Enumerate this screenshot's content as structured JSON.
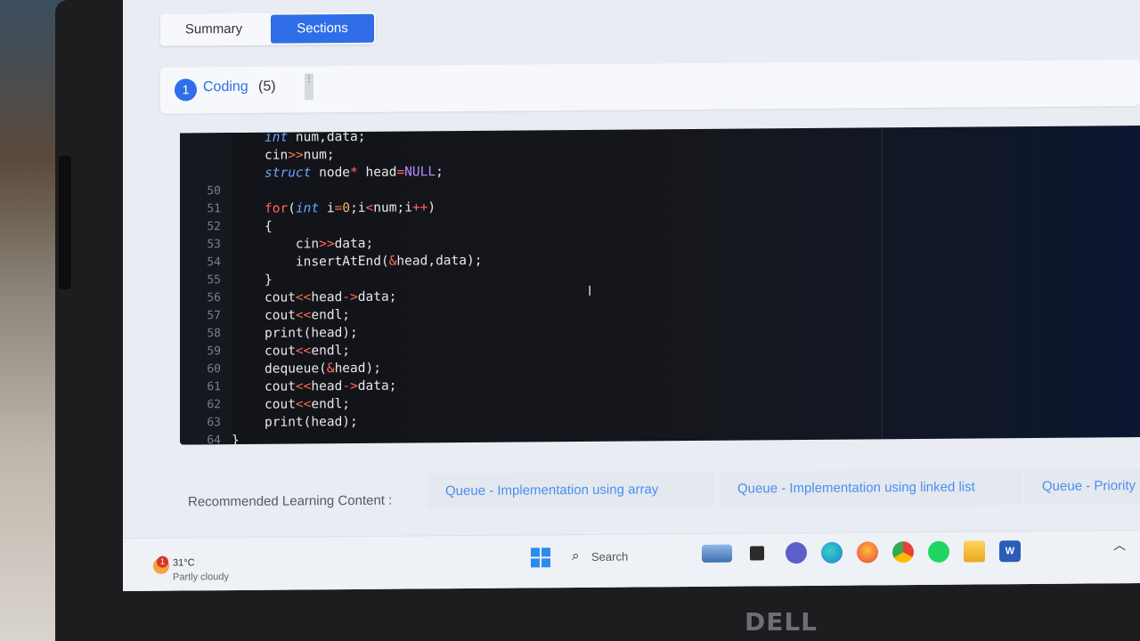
{
  "tabs": {
    "summary": "Summary",
    "sections": "Sections"
  },
  "section": {
    "number": "1",
    "name": "Coding",
    "count": "(5)"
  },
  "editor": {
    "lines": [
      {
        "n": "",
        "code": [
          [
            "kw",
            "int"
          ],
          [
            "t",
            " num,data;"
          ]
        ]
      },
      {
        "n": "",
        "code": [
          [
            "t",
            "cin"
          ],
          [
            "op",
            ">>"
          ],
          [
            "t",
            "num;"
          ]
        ]
      },
      {
        "n": "",
        "code": [
          [
            "kw",
            "struct"
          ],
          [
            "t",
            " node"
          ],
          [
            "op",
            "*"
          ],
          [
            "t",
            " head"
          ],
          [
            "op",
            "="
          ],
          [
            "cnst",
            "NULL"
          ],
          [
            "t",
            ";"
          ]
        ]
      },
      {
        "n": "50",
        "code": []
      },
      {
        "n": "51",
        "code": [
          [
            "kwr",
            "for"
          ],
          [
            "t",
            "("
          ],
          [
            "kw",
            "int"
          ],
          [
            "t",
            " i"
          ],
          [
            "op",
            "="
          ],
          [
            "num",
            "0"
          ],
          [
            "t",
            ";i"
          ],
          [
            "op",
            "<"
          ],
          [
            "t",
            "num;i"
          ],
          [
            "op",
            "++"
          ],
          [
            "t",
            ")"
          ]
        ]
      },
      {
        "n": "52",
        "code": [
          [
            "t",
            "{"
          ]
        ]
      },
      {
        "n": "53",
        "code": [
          [
            "t",
            "    cin"
          ],
          [
            "op",
            ">>"
          ],
          [
            "t",
            "data;"
          ]
        ]
      },
      {
        "n": "54",
        "code": [
          [
            "t",
            "    insertAtEnd("
          ],
          [
            "op",
            "&"
          ],
          [
            "t",
            "head,data);"
          ]
        ]
      },
      {
        "n": "55",
        "code": [
          [
            "t",
            "}"
          ]
        ]
      },
      {
        "n": "56",
        "code": [
          [
            "t",
            "cout"
          ],
          [
            "op",
            "<<"
          ],
          [
            "t",
            "head"
          ],
          [
            "op",
            "->"
          ],
          [
            "t",
            "data;"
          ]
        ]
      },
      {
        "n": "57",
        "code": [
          [
            "t",
            "cout"
          ],
          [
            "op",
            "<<"
          ],
          [
            "t",
            "endl;"
          ]
        ]
      },
      {
        "n": "58",
        "code": [
          [
            "t",
            "print(head);"
          ]
        ]
      },
      {
        "n": "59",
        "code": [
          [
            "t",
            "cout"
          ],
          [
            "op",
            "<<"
          ],
          [
            "t",
            "endl;"
          ]
        ]
      },
      {
        "n": "60",
        "code": [
          [
            "t",
            "dequeue("
          ],
          [
            "op",
            "&"
          ],
          [
            "t",
            "head);"
          ]
        ]
      },
      {
        "n": "61",
        "code": [
          [
            "t",
            "cout"
          ],
          [
            "op",
            "<<"
          ],
          [
            "t",
            "head"
          ],
          [
            "op",
            "->"
          ],
          [
            "t",
            "data;"
          ]
        ]
      },
      {
        "n": "62",
        "code": [
          [
            "t",
            "cout"
          ],
          [
            "op",
            "<<"
          ],
          [
            "t",
            "endl;"
          ]
        ]
      },
      {
        "n": "63",
        "code": [
          [
            "t",
            "print(head);"
          ]
        ]
      },
      {
        "n": "64",
        "code": [
          [
            "t",
            "}"
          ]
        ]
      }
    ]
  },
  "recommended": {
    "label": "Recommended Learning Content :",
    "items": [
      "Queue - Implementation using array",
      "Queue - Implementation using linked list",
      "Queue - Priority Q"
    ]
  },
  "taskbar": {
    "weather_temp": "31°C",
    "weather_desc": "Partly cloudy",
    "weather_alert": "1",
    "search_label": "Search",
    "word_icon_label": "W"
  },
  "bezel": {
    "brand": "DELL"
  },
  "colors": {
    "accent": "#2f6ee8",
    "link": "#4a8ff0",
    "editor_bg": "#111318",
    "keyword": "#6aa8ff",
    "operator": "#ff6b5a"
  }
}
